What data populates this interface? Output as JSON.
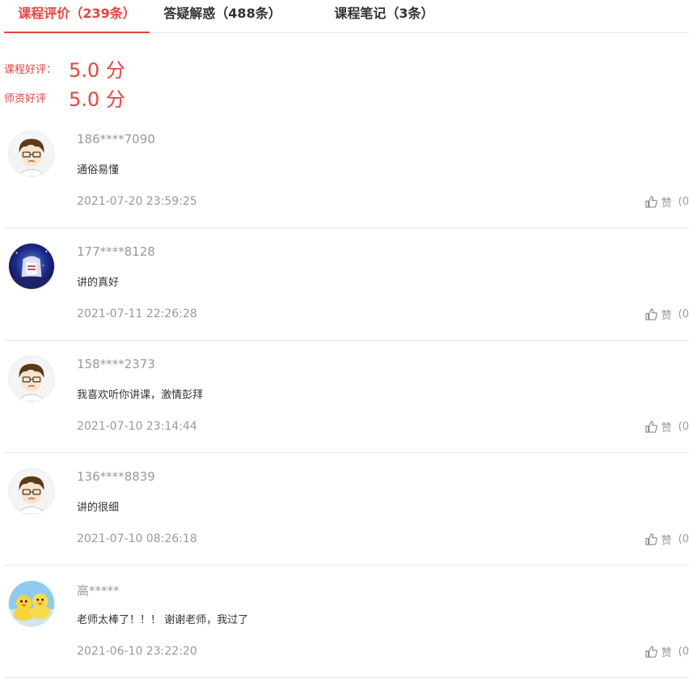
{
  "tabs": [
    {
      "label": "课程评价（239条）"
    },
    {
      "label": "答疑解惑（488条）"
    },
    {
      "label": "课程笔记（3条）"
    }
  ],
  "ratings": {
    "course_label": "课程好评：",
    "course_value": "5.0 分",
    "teacher_label": "师资好评",
    "teacher_value": "5.0 分"
  },
  "like_label": "赞",
  "like_count": "(0",
  "colors": {
    "accent": "#e8443e",
    "muted": "#999999",
    "border": "#e8e8e8"
  },
  "reviews": [
    {
      "user": "186****7090",
      "text": "通俗易懂",
      "time": "2021-07-20 23:59:25",
      "avatar": "cartoon-boy-avatar"
    },
    {
      "user": "177****8128",
      "text": "讲的真好",
      "time": "2021-07-11 22:26:28",
      "avatar": "night-landscape-avatar"
    },
    {
      "user": "158****2373",
      "text": "我喜欢听你讲课，激情彭拜",
      "time": "2021-07-10 23:14:44",
      "avatar": "cartoon-boy-avatar"
    },
    {
      "user": "136****8839",
      "text": "讲的很细",
      "time": "2021-07-10 08:26:18",
      "avatar": "cartoon-boy-avatar"
    },
    {
      "user": "高*****",
      "text": "老师太棒了！！！ 谢谢老师，我过了",
      "time": "2021-06-10 23:22:20",
      "avatar": "yellow-ducks-avatar"
    }
  ]
}
